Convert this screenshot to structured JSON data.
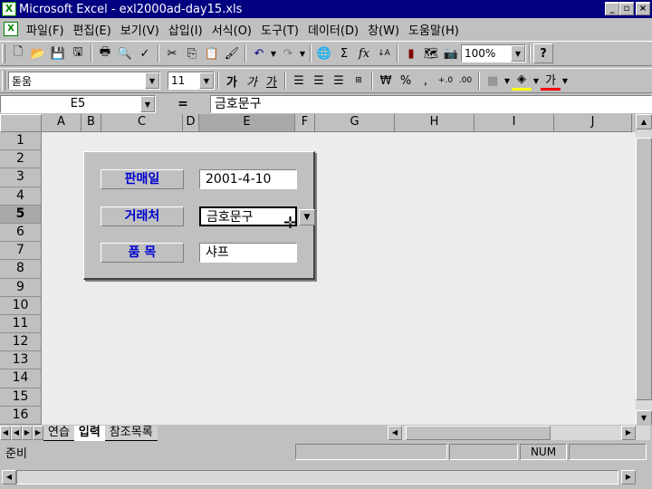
{
  "window": {
    "title": "Microsoft Excel - exl2000ad-day15.xls",
    "app_icon": "excel-icon",
    "min_label": "_",
    "max_label": "▫",
    "close_label": "×"
  },
  "menubar": {
    "items": [
      "파일(F)",
      "편집(E)",
      "보기(V)",
      "삽입(I)",
      "서식(O)",
      "도구(T)",
      "데이터(D)",
      "창(W)",
      "도움말(H)"
    ]
  },
  "toolbar_standard": {
    "zoom": "100%"
  },
  "toolbar_format": {
    "font_name": "돋움",
    "font_size": "11",
    "bold": "가",
    "italic": "가",
    "underline": "가",
    "currency": "₩",
    "percent": "%",
    "inc_decimal": "+.0",
    "dec_decimal": ".00",
    "font_color_glyph": "가"
  },
  "formula_bar": {
    "name_box": "E5",
    "equals": "=",
    "content": "금호문구"
  },
  "grid": {
    "columns": [
      "A",
      "B",
      "C",
      "D",
      "E",
      "F",
      "G",
      "H",
      "I",
      "J"
    ],
    "rows": [
      "1",
      "2",
      "3",
      "4",
      "5",
      "6",
      "7",
      "8",
      "9",
      "10",
      "11",
      "12",
      "13",
      "14",
      "15",
      "16"
    ],
    "active_column": "E",
    "active_row": "5"
  },
  "form": {
    "sale_date_label": "판매일",
    "sale_date_value": "2001-4-10",
    "client_label": "거래처",
    "client_value": "금호문구",
    "item_label": "품  목",
    "item_value": "샤프"
  },
  "sheet_tabs": [
    "연습",
    "입력",
    "참조목록"
  ],
  "active_sheet": "입력",
  "status": {
    "ready": "준비",
    "num": "NUM"
  }
}
